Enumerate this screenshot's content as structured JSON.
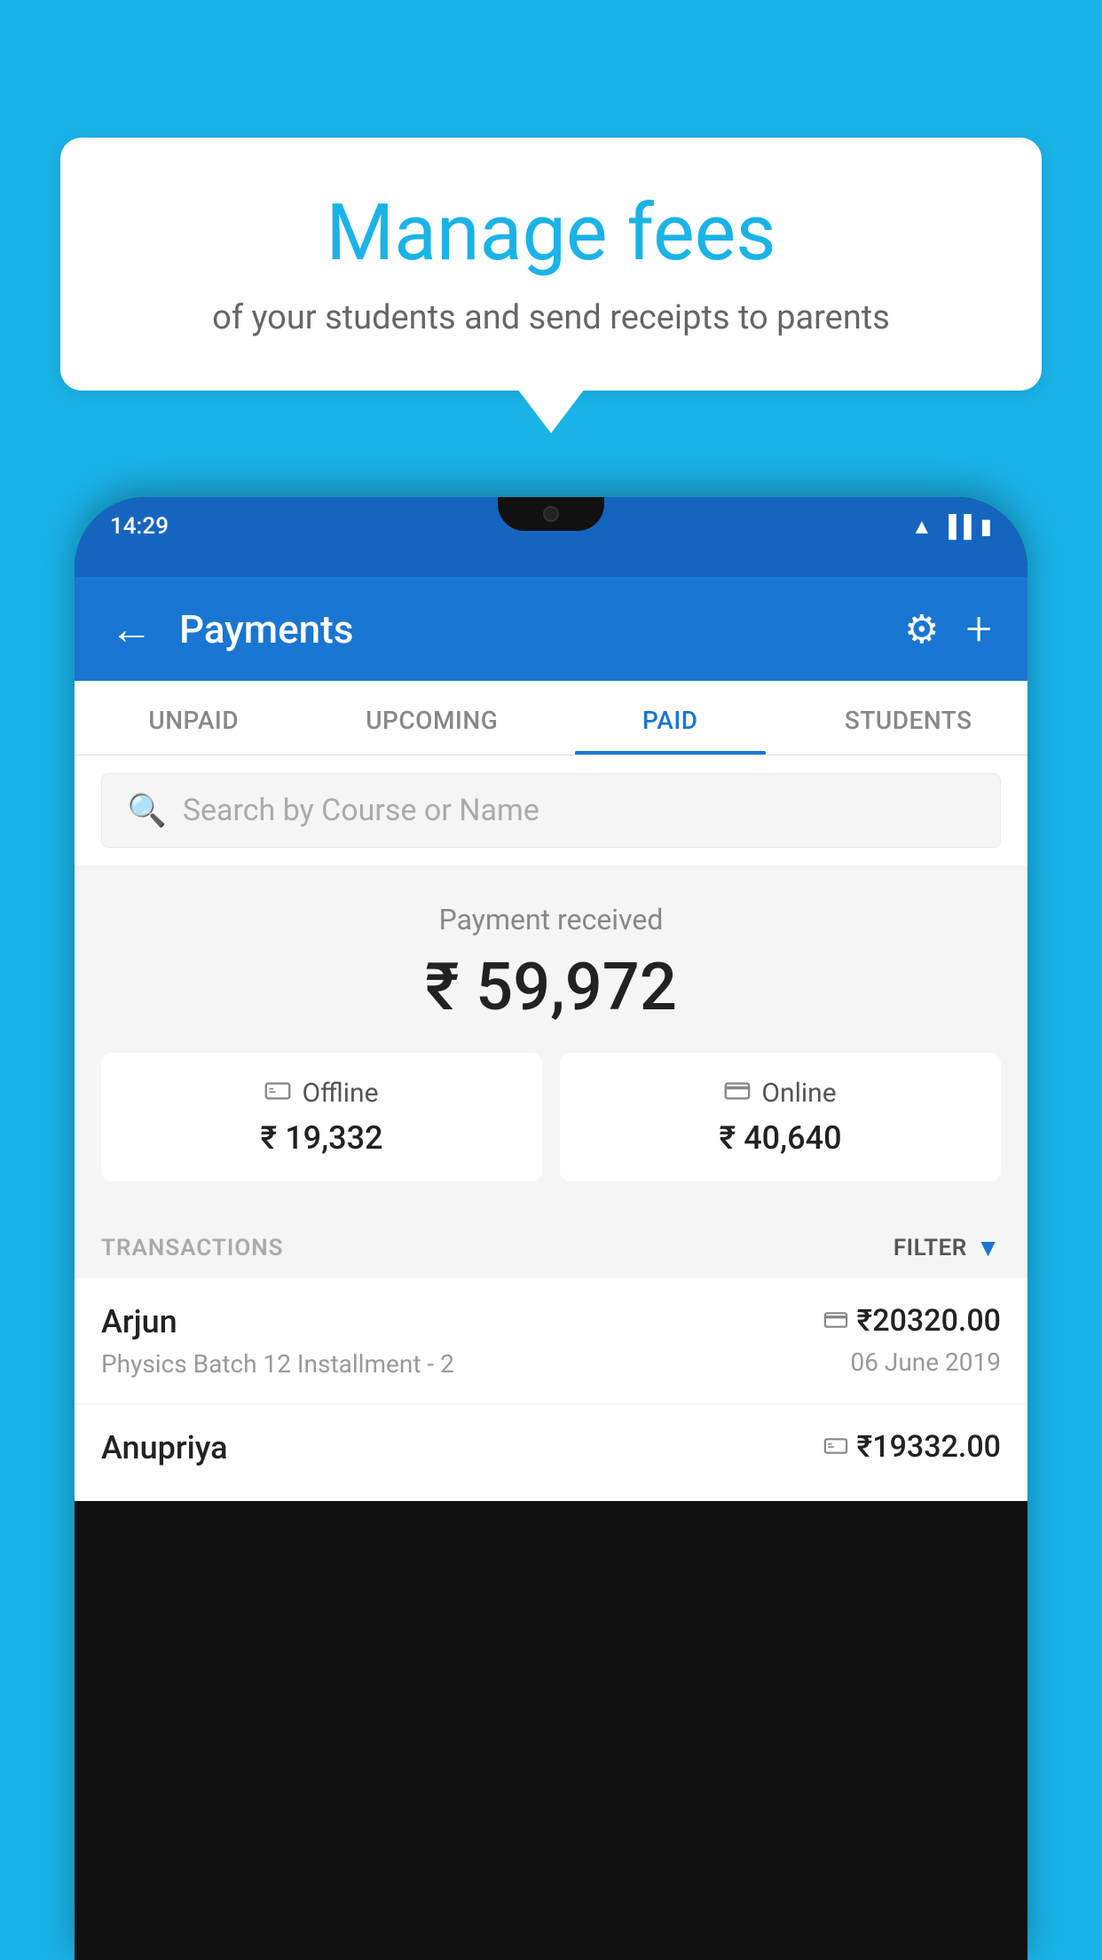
{
  "background_color": "#1ab3e8",
  "speech_bubble": {
    "title": "Manage fees",
    "subtitle": "of your students and send receipts to parents"
  },
  "status_bar": {
    "time": "14:29",
    "icons": [
      "wifi",
      "signal",
      "battery"
    ]
  },
  "app_header": {
    "title": "Payments",
    "back_label": "←",
    "settings_label": "⚙",
    "add_label": "+"
  },
  "tabs": [
    {
      "label": "UNPAID",
      "active": false
    },
    {
      "label": "UPCOMING",
      "active": false
    },
    {
      "label": "PAID",
      "active": true
    },
    {
      "label": "STUDENTS",
      "active": false
    }
  ],
  "search": {
    "placeholder": "Search by Course or Name"
  },
  "payment_summary": {
    "label": "Payment received",
    "amount": "₹ 59,972",
    "cards": [
      {
        "type": "Offline",
        "amount": "₹ 19,332",
        "icon": "💳"
      },
      {
        "type": "Online",
        "amount": "₹ 40,640",
        "icon": "💳"
      }
    ]
  },
  "transactions": {
    "header_label": "TRANSACTIONS",
    "filter_label": "FILTER",
    "rows": [
      {
        "name": "Arjun",
        "detail": "Physics Batch 12 Installment - 2",
        "amount": "₹20320.00",
        "date": "06 June 2019",
        "payment_icon": "card"
      },
      {
        "name": "Anupriya",
        "detail": "",
        "amount": "₹19332.00",
        "date": "",
        "payment_icon": "cash"
      }
    ]
  }
}
